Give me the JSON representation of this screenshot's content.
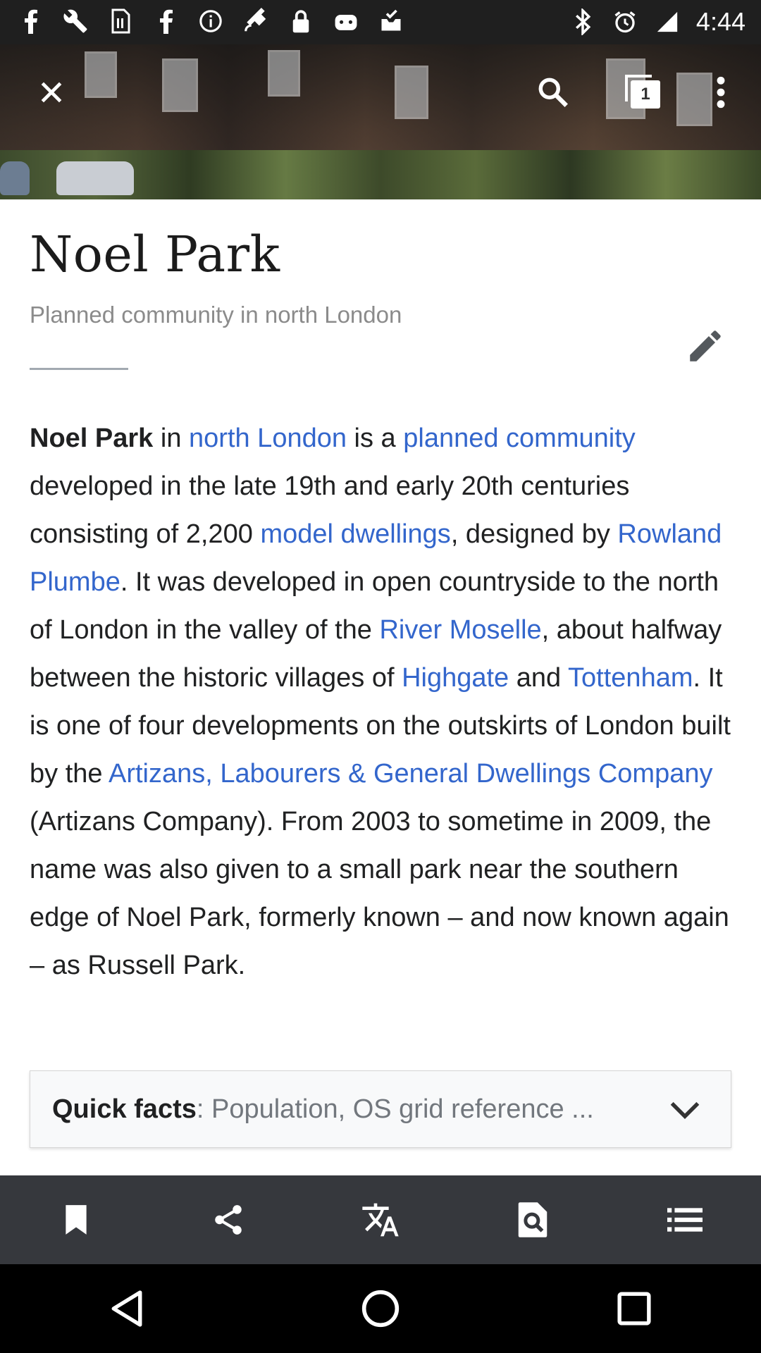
{
  "status_bar": {
    "time": "4:44",
    "left_icons": [
      "facebook-icon",
      "wrench-icon",
      "sim-icon",
      "facebook-icon",
      "info-icon",
      "satellite-icon",
      "lock-icon",
      "android-icon",
      "inbox-check-icon"
    ],
    "right_icons": [
      "bluetooth-icon",
      "alarm-icon",
      "signal-icon"
    ]
  },
  "header": {
    "tab_count": "1",
    "icons": [
      "close-icon",
      "search-icon",
      "tabs-icon",
      "more-vert-icon"
    ]
  },
  "article": {
    "title": "Noel Park",
    "description": "Planned community in north London",
    "body": {
      "s0": "Noel Park",
      "s1": " in ",
      "l1": "north London",
      "s2": " is a ",
      "l2": "planned community",
      "s3": " developed in the late 19th and early 20th centuries consisting of 2,200 ",
      "l3": "model dwellings",
      "s4": ", designed by ",
      "l4": "Rowland Plumbe",
      "s5": ". It was developed in open countryside to the north of London in the valley of the ",
      "l5": "River Moselle",
      "s6": ", about halfway between the historic villages of ",
      "l6": "Highgate",
      "s7": " and ",
      "l7": "Tottenham",
      "s8": ". It is one of four developments on the outskirts of London built by the ",
      "l8": "Artizans, Labourers & General Dwellings Company",
      "s9": " (Artizans Company). From 2003 to sometime in 2009, the name was also given to a small park near the southern edge of Noel Park, formerly known – and now known again – as Russell Park."
    },
    "quick_facts": {
      "label": "Quick facts",
      "summary": ": Population, OS grid reference ..."
    }
  },
  "toolbar": {
    "icons": [
      "bookmark-icon",
      "share-icon",
      "translate-icon",
      "find-in-page-icon",
      "contents-icon"
    ]
  },
  "colors": {
    "link": "#3366cc",
    "toolbar_bg": "#36383d",
    "status_bar_bg": "#1f1f1f"
  }
}
